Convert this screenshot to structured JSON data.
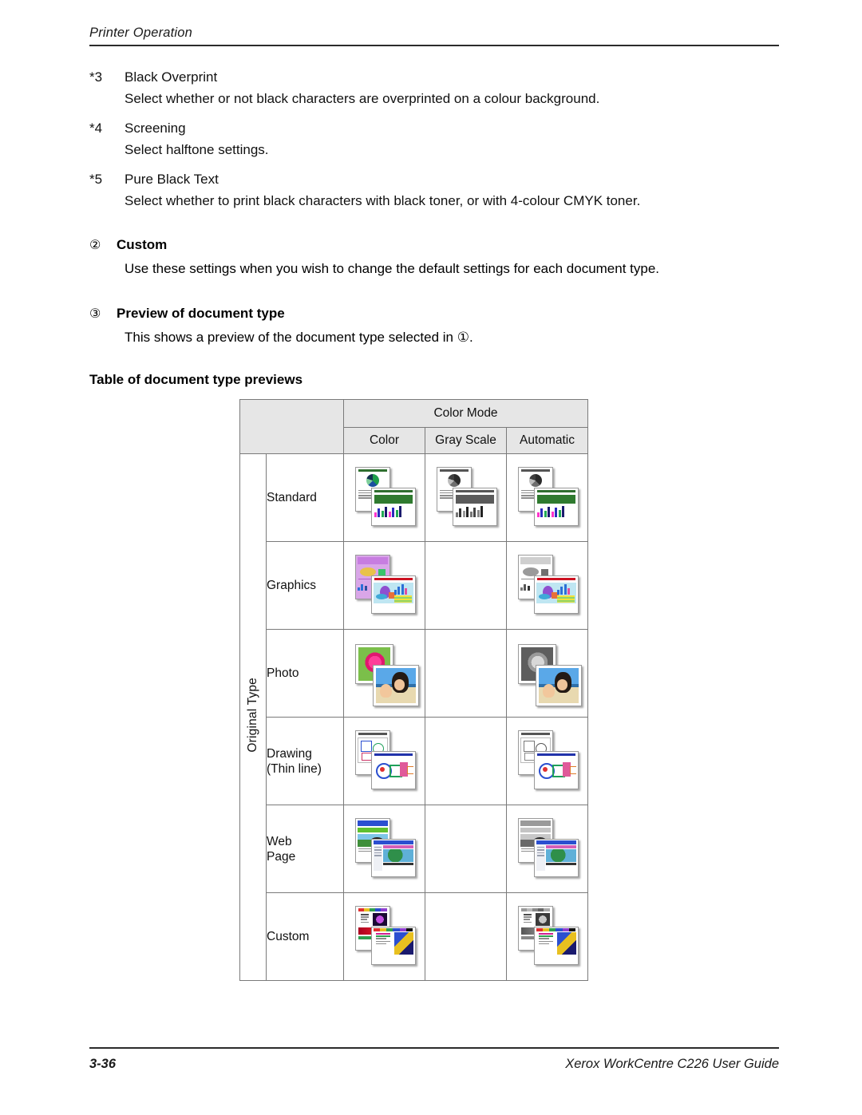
{
  "header": {
    "running_head": "Printer Operation"
  },
  "footnotes": [
    {
      "marker": "*3",
      "title": "Black Overprint",
      "description": "Select whether or not black characters are overprinted on a colour background."
    },
    {
      "marker": "*4",
      "title": "Screening",
      "description": "Select halftone settings."
    },
    {
      "marker": "*5",
      "title": "Pure Black Text",
      "description": "Select whether to print black characters with black toner, or with 4-colour CMYK toner."
    }
  ],
  "sections": [
    {
      "number": "②",
      "heading": "Custom",
      "body": "Use these settings when you wish to change the default settings for each document type."
    },
    {
      "number": "③",
      "heading": "Preview of document type",
      "body": "This shows a preview of the document type selected in ①."
    }
  ],
  "table": {
    "caption": "Table of document type previews",
    "group_header": "Color Mode",
    "column_headers": [
      "Color",
      "Gray Scale",
      "Automatic"
    ],
    "row_axis_label": "Original Type",
    "rows": [
      {
        "label": "Standard",
        "label_line2": "",
        "cells": [
          "standard-color",
          "standard-gray",
          "standard-auto"
        ]
      },
      {
        "label": "Graphics",
        "label_line2": "",
        "cells": [
          "graphics-color",
          "",
          "graphics-auto"
        ]
      },
      {
        "label": "Photo",
        "label_line2": "",
        "cells": [
          "photo-color",
          "",
          "photo-auto"
        ]
      },
      {
        "label": "Drawing",
        "label_line2": "(Thin line)",
        "cells": [
          "drawing-color",
          "",
          "drawing-auto"
        ]
      },
      {
        "label": "Web",
        "label_line2": "Page",
        "cells": [
          "web-color",
          "",
          "web-auto"
        ]
      },
      {
        "label": "Custom",
        "label_line2": "",
        "cells": [
          "custom-color",
          "",
          "custom-auto"
        ]
      }
    ]
  },
  "footer": {
    "page_number": "3-36",
    "guide_title": "Xerox WorkCentre C226 User Guide"
  },
  "colors": {
    "header_fill": "#e6e6e6",
    "rule": "#2b2b2b",
    "grid_line": "#7a7a7a"
  }
}
